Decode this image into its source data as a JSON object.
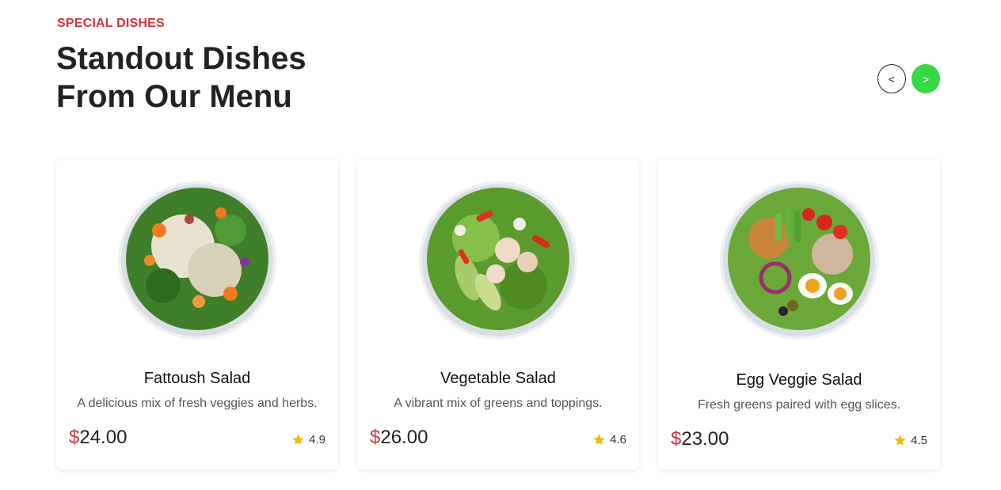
{
  "header": {
    "eyebrow": "SPECIAL DISHES",
    "title_line1": "Standout Dishes",
    "title_line2": "From Our Menu"
  },
  "nav": {
    "prev_label": "<",
    "next_label": ">"
  },
  "dishes": [
    {
      "name": "Fattoush Salad",
      "description": "A delicious mix of fresh veggies and herbs.",
      "currency": "$",
      "price": "24.00",
      "rating": "4.9",
      "image": "salad-bowl-image"
    },
    {
      "name": "Vegetable Salad",
      "description": "A vibrant mix of greens and toppings.",
      "currency": "$",
      "price": "26.00",
      "rating": "4.6",
      "image": "salad-bowl-image"
    },
    {
      "name": "Egg Veggie Salad",
      "description": "Fresh greens paired with egg slices.",
      "currency": "$",
      "price": "23.00",
      "rating": "4.5",
      "image": "salad-bowl-image"
    }
  ],
  "colors": {
    "accent_red": "#d0343c",
    "accent_green": "#39d847",
    "star": "#f5b700"
  }
}
